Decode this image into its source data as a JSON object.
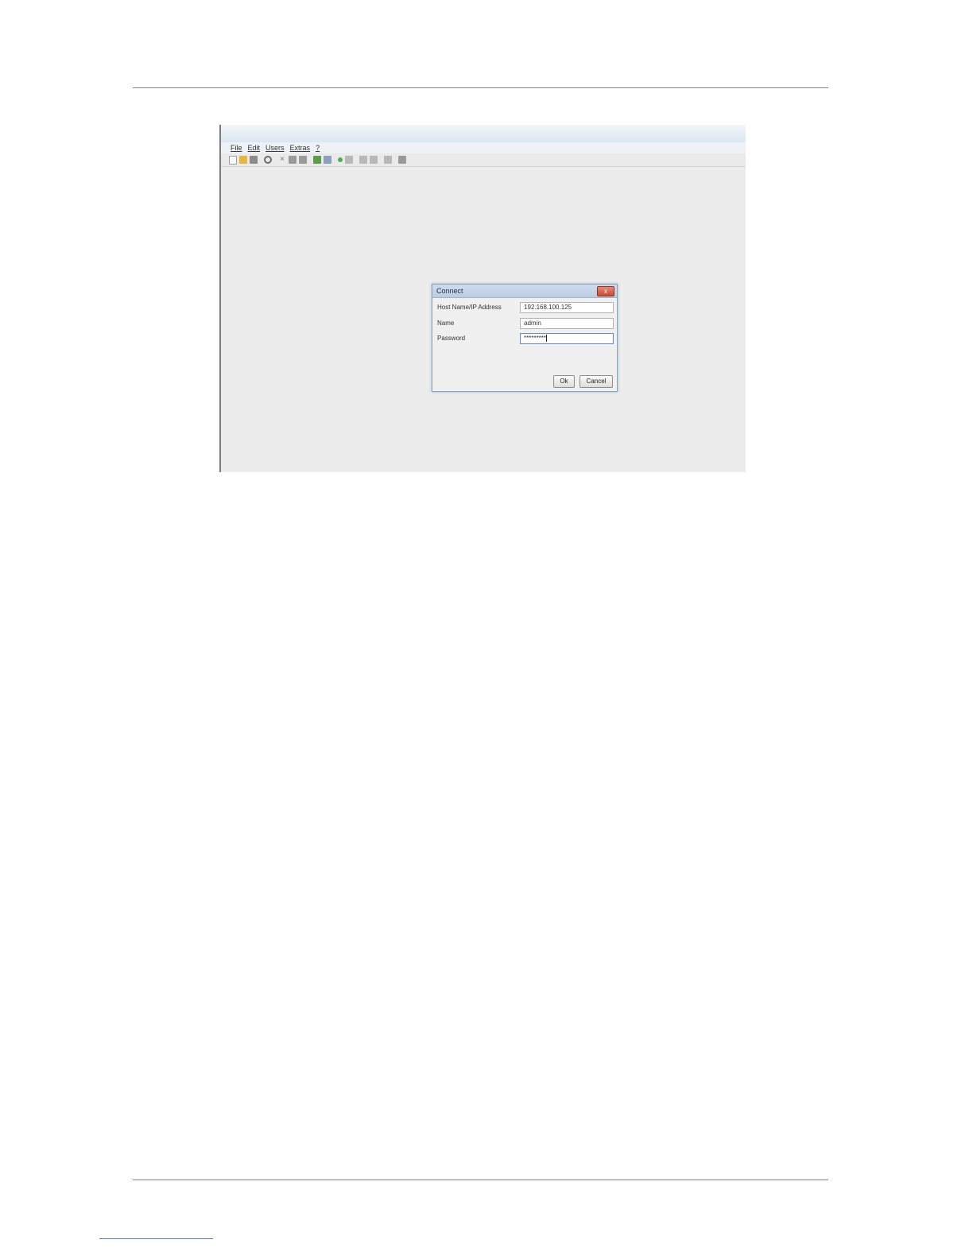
{
  "menu": [
    "File",
    "Edit",
    "Users",
    "Extras",
    "?"
  ],
  "toolbar_icons": [
    "new-document-icon",
    "open-folder-icon",
    "save-icon",
    "refresh-icon",
    "delete-icon",
    "copy-icon",
    "paste-icon",
    "connect-icon",
    "disconnect-icon",
    "add-icon",
    "network-icon",
    "document-icon",
    "document-icon",
    "document-icon",
    "folder-icon"
  ],
  "dialog": {
    "title": "Connect",
    "close_label": "x",
    "fields": {
      "host_label": "Host Name/IP Address",
      "host_value": "192.168.100.125",
      "name_label": "Name",
      "name_value": "admin",
      "password_label": "Password",
      "password_value": "*********"
    },
    "ok_label": "Ok",
    "cancel_label": "Cancel"
  }
}
